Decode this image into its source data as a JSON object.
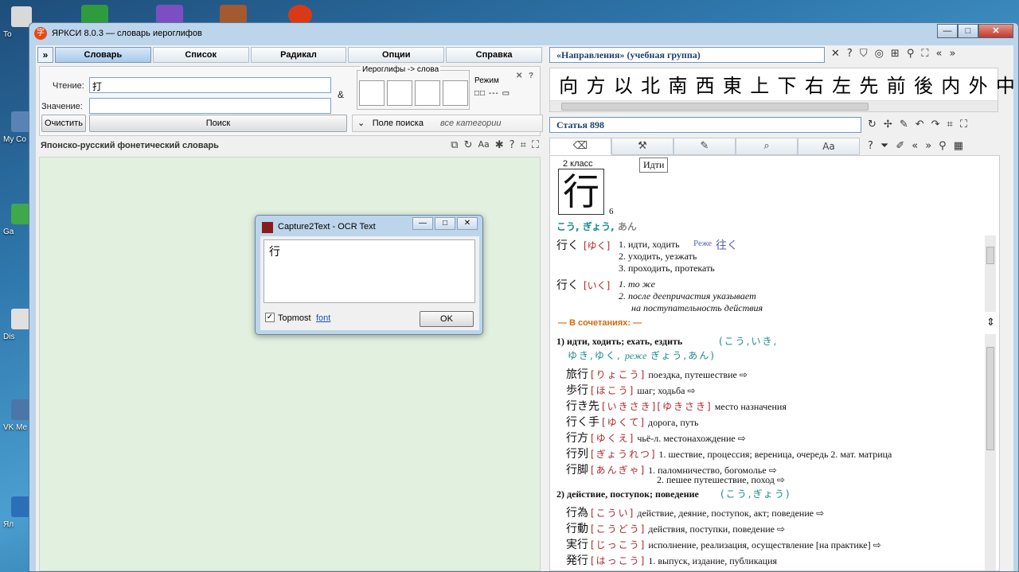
{
  "desktop": {
    "icons": [
      {
        "label": "To",
        "color": "#d9d9d9"
      },
      {
        "label": "My Co",
        "color": "#5a83b5"
      },
      {
        "label": "Ga",
        "color": "#3ea84b"
      },
      {
        "label": "Dis",
        "color": "#e0e0e0"
      },
      {
        "label": "VK Me",
        "color": "#4b76a8"
      },
      {
        "label": "Ял",
        "color": "#2c6fb8"
      }
    ]
  },
  "window": {
    "title": "ЯРКСИ 8.0.3 — словарь иероглифов",
    "app_icon": "字",
    "btn_minimize": "—",
    "btn_maximize": "□",
    "btn_close": "✕"
  },
  "left": {
    "nav_button": "»",
    "tabs": [
      "Словарь",
      "Список",
      "Радикал",
      "Опции",
      "Справка"
    ],
    "reading_label": "Чтение:",
    "reading_value": "打",
    "meaning_label": "Значение:",
    "meaning_value": "",
    "amp": "&",
    "hieroglyphs_caption": "Иероглифы -> слова",
    "mode_label": "Режим",
    "mode_close": "✕",
    "mode_help": "?",
    "mode_dots": "□□ --- ▭",
    "clear_button": "Очистить",
    "search_button": "Поиск",
    "field_select_label": "Поле поиска",
    "field_select_value": "все категории",
    "dict_title": "Японско-русский фонетический словарь"
  },
  "right": {
    "group_bar": "«Направления»  (учебная группа)",
    "hanzi": [
      "向",
      "方",
      "以",
      "北",
      "南",
      "西",
      "東",
      "上",
      "下",
      "右",
      "左",
      "先",
      "前",
      "後",
      "内",
      "外",
      "中"
    ],
    "article_bar": "Статья 898",
    "tooltip": "Идти",
    "grade": "2 класс",
    "kanji": "行",
    "strokes": "6",
    "readings_main": "こう, ぎょう, ",
    "readings_gray": "あん",
    "entries": [
      {
        "kanji": "行く",
        "kana": "[ゆく]",
        "senses": [
          "1. идти, ходить",
          "2. уходить, уезжать",
          "3. проходить, протекать"
        ],
        "note": "Реже",
        "alt": "往く"
      },
      {
        "kanji": "行く",
        "kana": "[いく]",
        "senses": [
          "1. то же",
          "2. после деепричастия указывает",
          "на поступательность действия"
        ]
      }
    ],
    "combos_header": "— В сочетаниях: —",
    "sec1_title": "1) идти, ходить;  ехать, ездить",
    "sec1_readings": "(こう,いき,",
    "sec1_readings2": "ゆき,ゆく,",
    "sec1_rare": "реже",
    "sec1_readings3": "ぎょう,あん)",
    "sec1_words": [
      {
        "w": "旅行",
        "r": "[りょこう]",
        "m": "поездка, путешествие ⇨"
      },
      {
        "w": "歩行",
        "r": "[ほこう]",
        "m": "шаг;  ходьба ⇨"
      },
      {
        "w": "行き先",
        "r": "[いきさき][ゆきさき]",
        "m": "место назначения"
      },
      {
        "w": "行く手",
        "r": "[ゆくて]",
        "m": "дорога, путь"
      },
      {
        "w": "行方",
        "r": "[ゆくえ]",
        "m": "чьё-л.  местонахождение ⇨"
      },
      {
        "w": "行列",
        "r": "[ぎょうれつ]",
        "m": "1. шествие, процессия;  вереница, очередь  2. мат. матрица"
      },
      {
        "w": "行脚",
        "r": "[あんぎゃ]",
        "m": "1. паломничество, богомолье ⇨"
      }
    ],
    "sec1_last_line2": "2. пешее путешествие, поход ⇨",
    "sec2_title": "2) действие, поступок;  поведение",
    "sec2_readings": "(こう,ぎょう)",
    "sec2_words": [
      {
        "w": "行為",
        "r": "[こうい]",
        "m": "действие, деяние, поступок, акт;  поведение ⇨"
      },
      {
        "w": "行動",
        "r": "[こうどう]",
        "m": "действия, поступки, поведение ⇨"
      },
      {
        "w": "実行",
        "r": "[じっこう]",
        "m": "исполнение, реализация, осуществление [на практике] ⇨"
      },
      {
        "w": "発行",
        "r": "[はっこう]",
        "m": "1. выпуск, издание, публикация"
      }
    ]
  },
  "popup": {
    "title": "Capture2Text - OCR Text",
    "text": "行",
    "topmost_label": "Topmost",
    "topmost_checked": "✓",
    "font_link": "font",
    "ok_button": "OK"
  }
}
